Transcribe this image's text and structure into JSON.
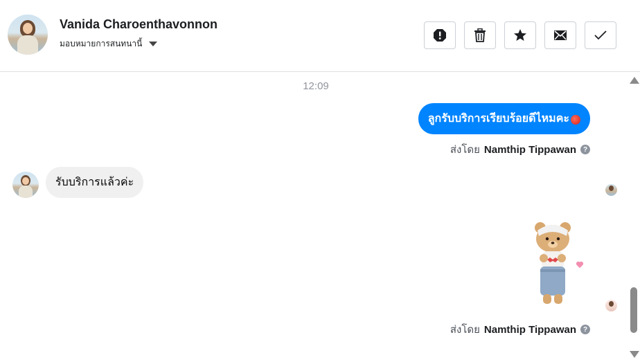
{
  "header": {
    "contact_name": "Vanida Charoenthavonnon",
    "assign_label": "มอบหมายการสนทนานี้",
    "actions": [
      {
        "name": "mark-as-spam",
        "icon": "exclamation-octagon-icon"
      },
      {
        "name": "delete",
        "icon": "trash-icon"
      },
      {
        "name": "star",
        "icon": "star-icon"
      },
      {
        "name": "mark-as-unread",
        "icon": "envelope-icon"
      },
      {
        "name": "mark-as-done",
        "icon": "checkmark-icon"
      }
    ]
  },
  "conversation": {
    "timestamp": "12:09",
    "messages": [
      {
        "direction": "outgoing",
        "text": "ลูกรับบริการเรียบร้อยดีไหมคะ",
        "emoji": "tomato-emoji"
      },
      {
        "direction": "incoming",
        "text": "รับบริการแล้วค่ะ"
      },
      {
        "direction": "outgoing",
        "type": "sticker",
        "sticker": "teddy-bear-sticker"
      }
    ],
    "sent_by_prefix": "ส่งโดย",
    "sent_by_name": "Namthip Tippawan",
    "help_glyph": "?"
  },
  "colors": {
    "outgoing_bubble": "#0084ff",
    "incoming_bubble": "#f1f0f0",
    "scrollbar": "#8a8a8a"
  }
}
